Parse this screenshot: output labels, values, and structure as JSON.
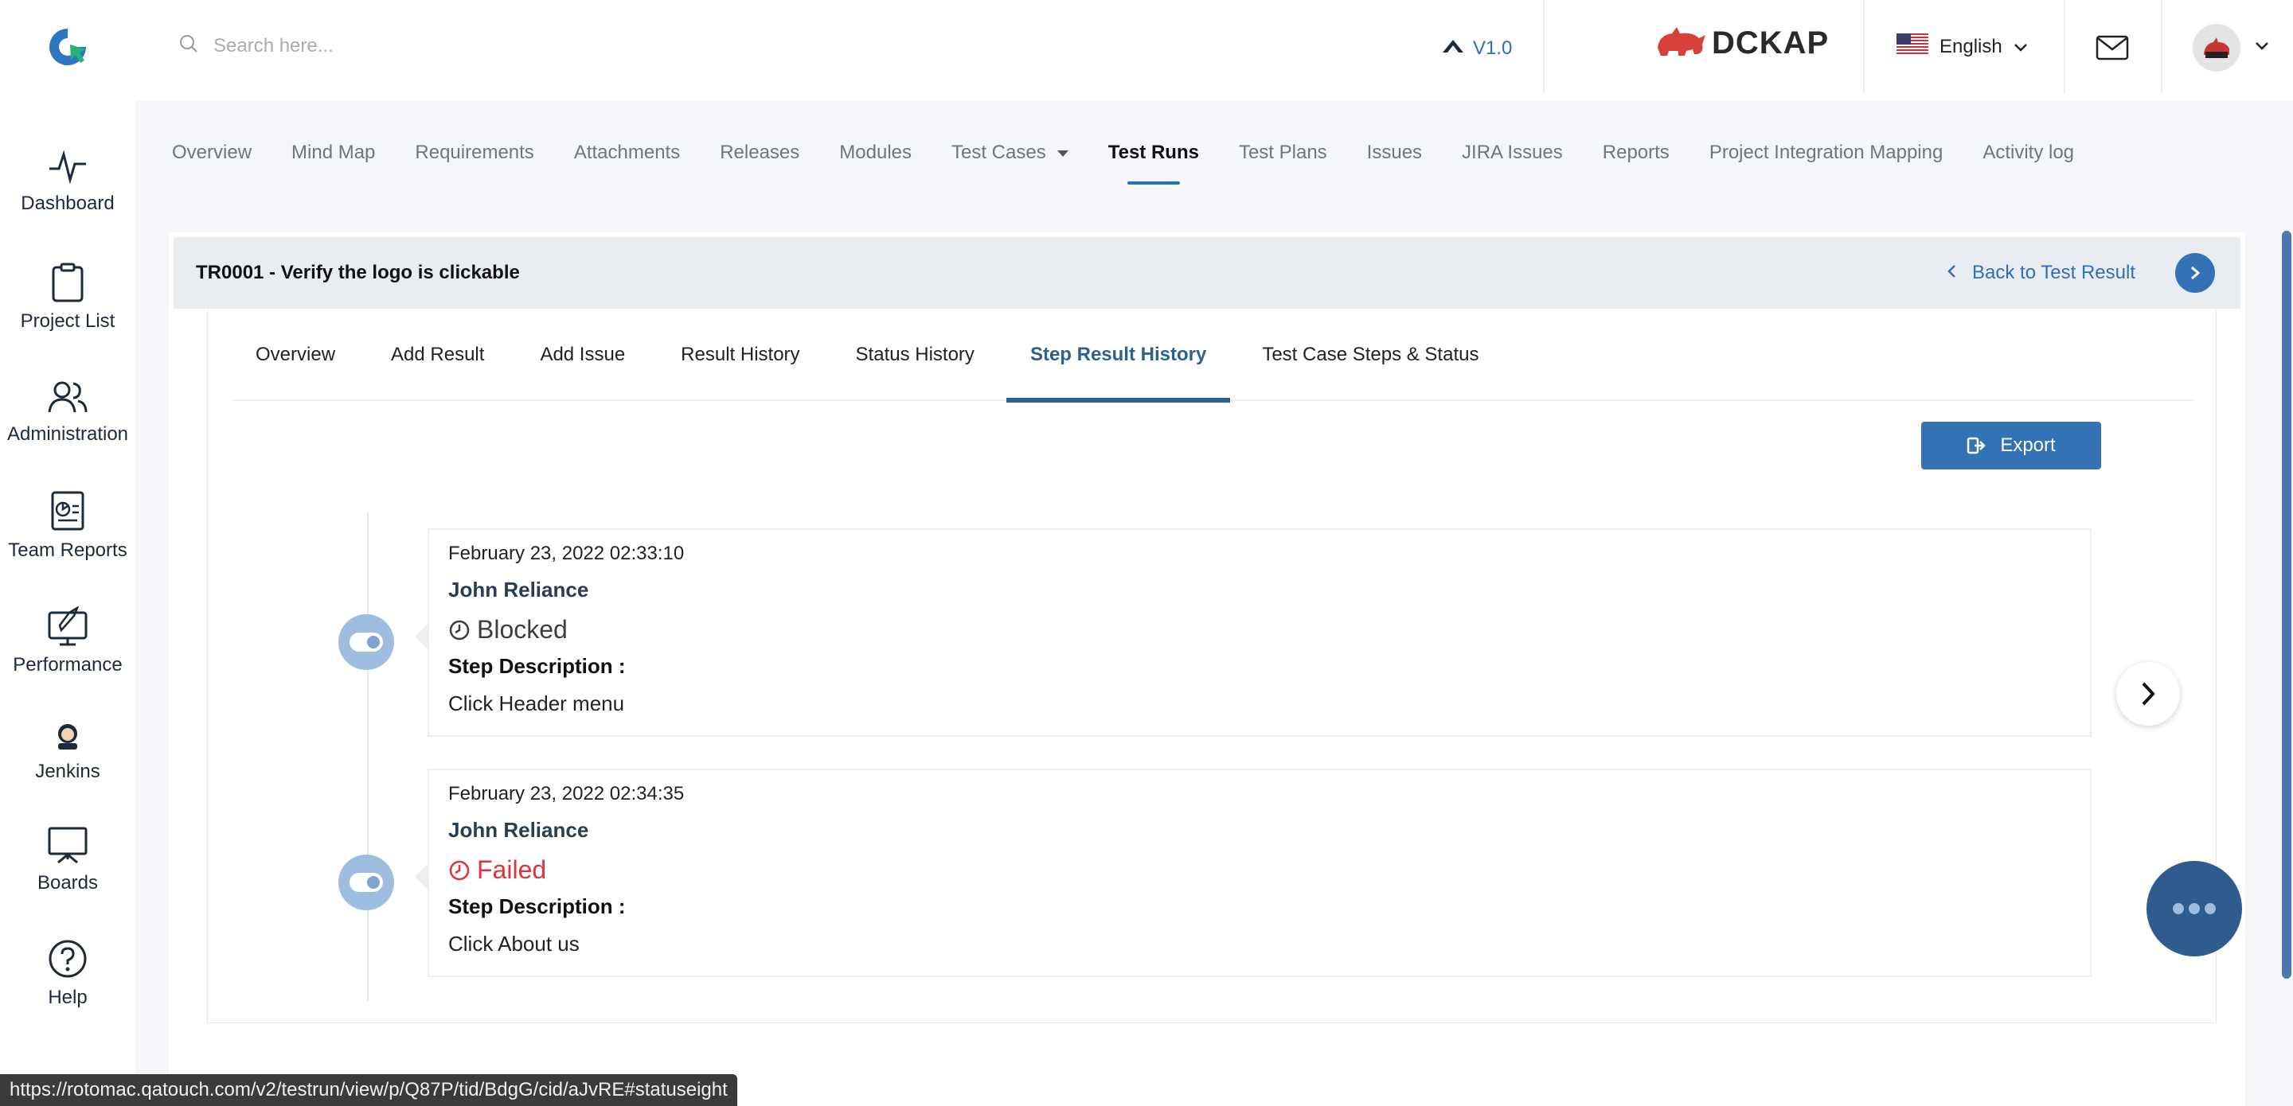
{
  "header": {
    "search_placeholder": "Search here...",
    "version": "V1.0",
    "brand": "DCKAP",
    "language": "English"
  },
  "sidebar": {
    "items": [
      {
        "label": "Dashboard",
        "icon": "pulse-icon"
      },
      {
        "label": "Project List",
        "icon": "clipboard-icon"
      },
      {
        "label": "Administration",
        "icon": "users-icon"
      },
      {
        "label": "Team Reports",
        "icon": "report-icon"
      },
      {
        "label": "Performance",
        "icon": "rocket-icon"
      },
      {
        "label": "Jenkins",
        "icon": "jenkins-icon"
      },
      {
        "label": "Boards",
        "icon": "board-icon"
      },
      {
        "label": "Help",
        "icon": "help-icon"
      }
    ]
  },
  "project_nav": {
    "items": [
      "Overview",
      "Mind Map",
      "Requirements",
      "Attachments",
      "Releases",
      "Modules",
      "Test Cases",
      "Test Runs",
      "Test Plans",
      "Issues",
      "JIRA Issues",
      "Reports",
      "Project Integration Mapping",
      "Activity log"
    ],
    "active": "Test Runs"
  },
  "run": {
    "title": "TR0001 - Verify the logo is clickable",
    "back_label": "Back to Test Result"
  },
  "tabs": {
    "items": [
      "Overview",
      "Add Result",
      "Add Issue",
      "Result History",
      "Status History",
      "Step Result History",
      "Test Case Steps & Status"
    ],
    "active": "Step Result History"
  },
  "export_label": "Export",
  "history": [
    {
      "date": "February 23, 2022 02:33:10",
      "user": "John Reliance",
      "status": "Blocked",
      "status_color": "#3a3f45",
      "step_label": "Step Description :",
      "step_desc": "Click Header menu"
    },
    {
      "date": "February 23, 2022 02:34:35",
      "user": "John Reliance",
      "status": "Failed",
      "status_color": "#e0323a",
      "step_label": "Step Description :",
      "step_desc": "Click About us"
    }
  ],
  "status_url": "https://rotomac.qatouch.com/v2/testrun/view/p/Q87P/tid/BdgG/cid/aJvRE#statuseight",
  "colors": {
    "accent": "#3472b6",
    "tab_active": "#2f5f92",
    "failed": "#e0323a"
  }
}
